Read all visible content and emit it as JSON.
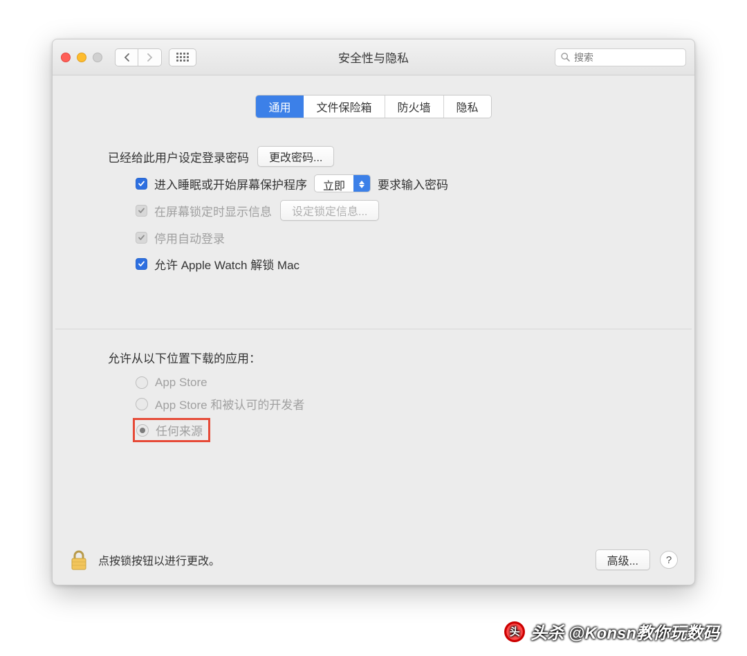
{
  "window": {
    "title": "安全性与隐私",
    "search_placeholder": "搜索"
  },
  "tabs": {
    "general": "通用",
    "filevault": "文件保险箱",
    "firewall": "防火墙",
    "privacy": "隐私"
  },
  "section1": {
    "login_pw_set": "已经给此用户设定登录密码",
    "change_password": "更改密码...",
    "require_pw_before": "进入睡眠或开始屏幕保护程序",
    "require_pw_after": "要求输入密码",
    "delay_value": "立即",
    "show_message": "在屏幕锁定时显示信息",
    "set_lock_message": "设定锁定信息...",
    "disable_autologin": "停用自动登录",
    "allow_watch": "允许 Apple Watch 解锁 Mac"
  },
  "section2": {
    "heading": "允许从以下位置下载的应用：",
    "opt_appstore": "App Store",
    "opt_identified": "App Store 和被认可的开发者",
    "opt_anywhere": "任何来源"
  },
  "footer": {
    "lock_text": "点按锁按钮以进行更改。",
    "advanced": "高级...",
    "help": "?"
  },
  "watermark": "头杀 @Konsn教你玩数码"
}
